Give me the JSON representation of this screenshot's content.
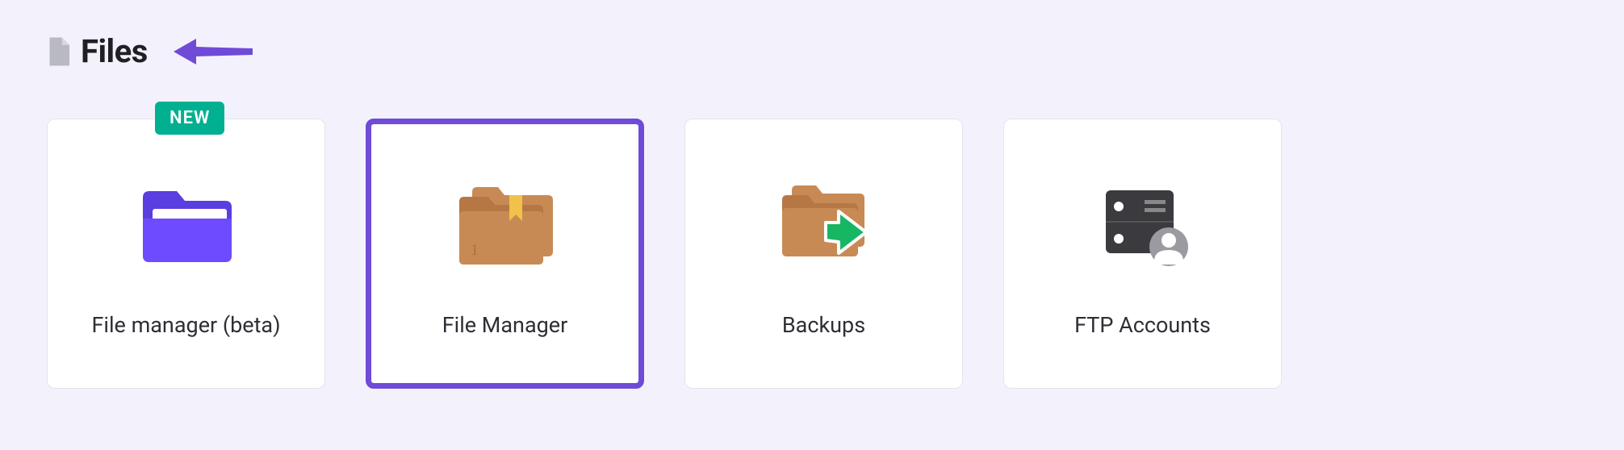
{
  "section": {
    "title": "Files"
  },
  "cards": [
    {
      "label": "File manager (beta)",
      "badge": "NEW"
    },
    {
      "label": "File Manager"
    },
    {
      "label": "Backups"
    },
    {
      "label": "FTP Accounts"
    }
  ]
}
